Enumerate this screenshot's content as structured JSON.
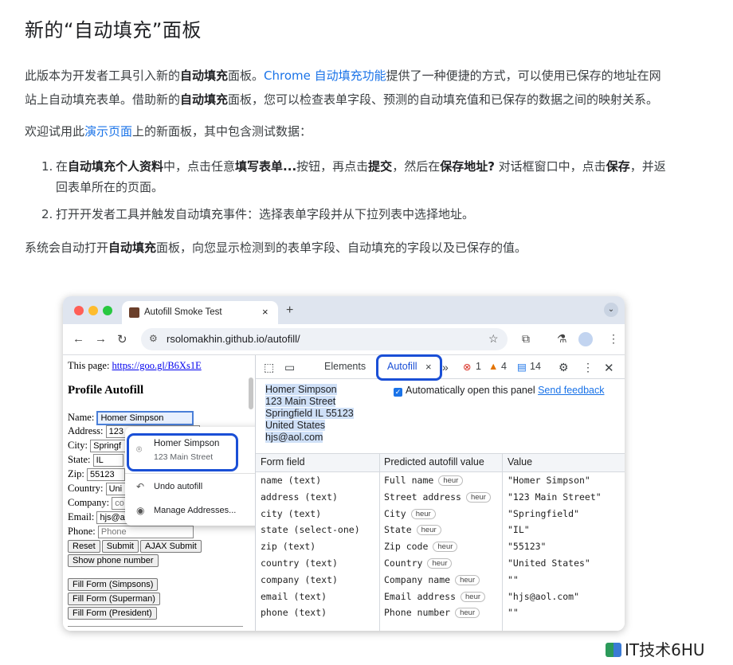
{
  "article": {
    "heading": "新的“自动填充”面板",
    "p1_a": "此版本为开发者工具引入新的",
    "p1_b": "自动填充",
    "p1_c": "面板。",
    "p1_link": "Chrome 自动填充功能",
    "p1_d": "提供了一种便捷的方式，可以使用已保存的地址在网",
    "p1_e": "站上自动填充表单。借助新的",
    "p1_f": "自动填充",
    "p1_g": "面板，您可以检查表单字段、预测的自动填充值和已保存的数据之间的映射关系。",
    "p2_a": "欢迎试用此",
    "p2_link": "演示页面",
    "p2_b": "上的新面板，其中包含测试数据：",
    "li1": [
      "1.",
      "在",
      "自动填充个人资料",
      "中，点击任意",
      "填写表单...",
      "按钮，再点击",
      "提交",
      "，然后在",
      "保存地址?",
      " 对话框窗口中，点击",
      "保存",
      "，并返"
    ],
    "li1_cont": "回表单所在的页面。",
    "li2": [
      "2.",
      "打开开发者工具并触发自动填充事件：选择表单字段并从下拉列表中选择地址。"
    ],
    "p3_a": "系统会自动打开",
    "p3_b": "自动填充",
    "p3_c": "面板，向您显示检测到的表单字段、自动填充的字段以及已保存的值。"
  },
  "browser": {
    "tab_title": "Autofill Smoke Test",
    "tab_close": "×",
    "new_tab": "+",
    "url": "rsolomakhin.github.io/autofill/"
  },
  "page": {
    "this_page_label": "This page:",
    "this_page_link": "https://goo.gl/B6Xs1E",
    "heading": "Profile Autofill",
    "fields": [
      {
        "label": "Name:",
        "value": "Homer Simpson"
      },
      {
        "label": "Address:",
        "value": "123"
      },
      {
        "label": "City:",
        "value": "Springf"
      },
      {
        "label": "State:",
        "value": "IL"
      },
      {
        "label": "Zip:",
        "value": "55123"
      },
      {
        "label": "Country:",
        "value": "Uni"
      },
      {
        "label": "Company:",
        "value": "co"
      },
      {
        "label": "Email:",
        "value": "hjs@a"
      },
      {
        "label": "Phone:",
        "value": "Phone"
      }
    ],
    "buttons": [
      "Reset",
      "Submit",
      "AJAX Submit"
    ],
    "show_phone": "Show phone number",
    "fill_buttons": [
      "Fill Form (Simpsons)",
      "Fill Form (Superman)",
      "Fill Form (President)"
    ]
  },
  "dropdown": {
    "name": "Homer Simpson",
    "street": "123 Main Street",
    "undo": "Undo autofill",
    "manage": "Manage Addresses..."
  },
  "devtools": {
    "elements_tab": "Elements",
    "autofill_tab": "Autofill",
    "more": "»",
    "errors": "1",
    "warnings": "4",
    "messages": "14",
    "address_lines": [
      "Homer Simpson",
      "123 Main Street",
      "Springfield IL 55123",
      "United States",
      "hjs@aol.com"
    ],
    "auto_open_label": "Automatically open this panel",
    "send_feedback": "Send feedback",
    "columns": [
      "Form field",
      "Predicted autofill value",
      "Value"
    ],
    "heur_label": "heur",
    "rows": [
      {
        "field": "name (text)",
        "predicted": "Full name",
        "value": "\"Homer Simpson\""
      },
      {
        "field": "address (text)",
        "predicted": "Street address",
        "value": "\"123 Main Street\""
      },
      {
        "field": "city (text)",
        "predicted": "City",
        "value": "\"Springfield\""
      },
      {
        "field": "state (select-one)",
        "predicted": "State",
        "value": "\"IL\""
      },
      {
        "field": "zip (text)",
        "predicted": "Zip code",
        "value": "\"55123\""
      },
      {
        "field": "country (text)",
        "predicted": "Country",
        "value": "\"United States\""
      },
      {
        "field": "company (text)",
        "predicted": "Company name",
        "value": "\"\""
      },
      {
        "field": "email (text)",
        "predicted": "Email address",
        "value": "\"hjs@aol.com\""
      },
      {
        "field": "phone (text)",
        "predicted": "Phone number",
        "value": "\"\""
      }
    ]
  },
  "watermark": "IT技术6HU"
}
